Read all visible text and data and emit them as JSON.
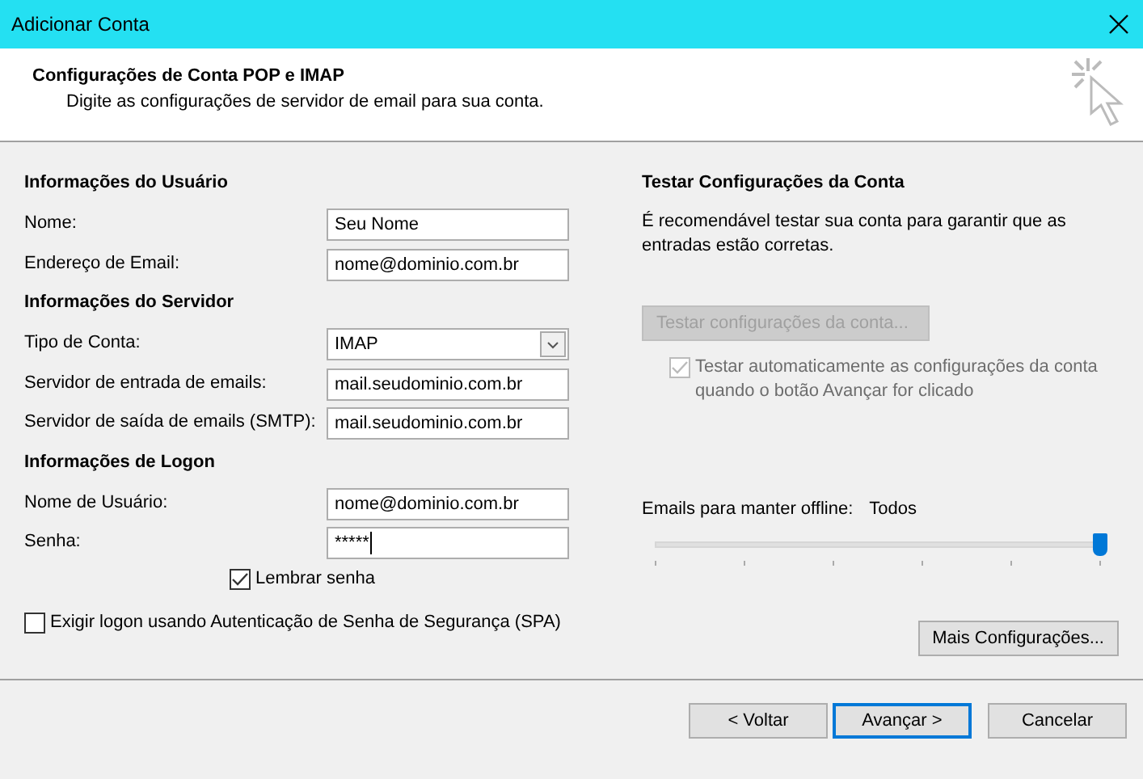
{
  "window": {
    "title": "Adicionar Conta"
  },
  "header": {
    "title": "Configurações de Conta POP e IMAP",
    "subtitle": "Digite as configurações de servidor de email para sua conta."
  },
  "sections": [
    {
      "heading": "Informações do Usuário",
      "fields": [
        {
          "label": "Nome:",
          "kind": "text",
          "value": "Seu Nome"
        },
        {
          "label": "Endereço de Email:",
          "kind": "text",
          "value": "nome@dominio.com.br"
        }
      ]
    },
    {
      "heading": "Informações do Servidor",
      "fields": [
        {
          "label": "Tipo de Conta:",
          "kind": "select",
          "value": "IMAP"
        },
        {
          "label": "Servidor de entrada de emails:",
          "kind": "text",
          "value": "mail.seudominio.com.br"
        },
        {
          "label": "Servidor de saída de emails (SMTP):",
          "kind": "text",
          "value": "mail.seudominio.com.br"
        }
      ]
    },
    {
      "heading": "Informações de Logon",
      "fields": [
        {
          "label": "Nome de Usuário:",
          "kind": "text",
          "value": "nome@dominio.com.br"
        },
        {
          "label": "Senha:",
          "kind": "password",
          "value": "*****"
        }
      ]
    }
  ],
  "remember": {
    "label": "Lembrar senha",
    "checked": true
  },
  "spa": {
    "label": "Exigir logon usando Autenticação de Senha de Segurança (SPA)",
    "checked": false
  },
  "test": {
    "heading": "Testar Configurações da Conta",
    "description": "É recomendável testar sua conta para garantir que as entradas estão corretas.",
    "button": {
      "label": "Testar configurações da conta...",
      "disabled": true
    },
    "auto_test": {
      "label": "Testar automaticamente as configurações da conta quando o botão Avançar for clicado",
      "checked": true,
      "disabled": true
    }
  },
  "offline": {
    "label": "Emails para manter offline:",
    "value": "Todos",
    "level": 1
  },
  "more_button": "Mais Configurações...",
  "buttons": [
    {
      "label": "< Voltar",
      "default": false
    },
    {
      "label": "Avançar >",
      "default": true
    },
    {
      "label": "Cancelar",
      "default": false
    }
  ]
}
